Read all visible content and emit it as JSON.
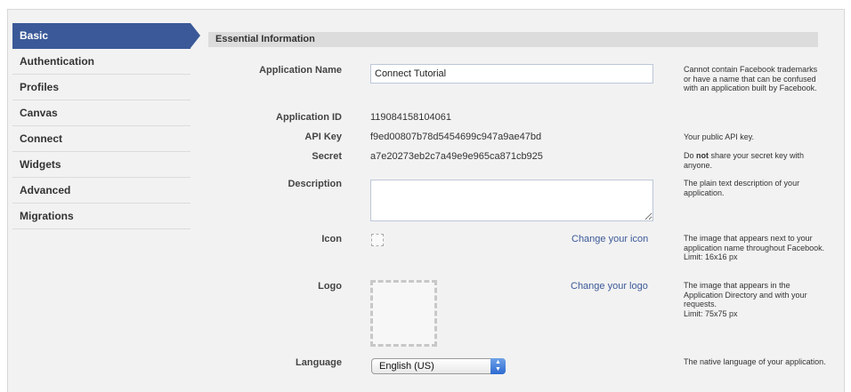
{
  "sidebar": {
    "items": [
      {
        "label": "Basic",
        "active": true
      },
      {
        "label": "Authentication"
      },
      {
        "label": "Profiles"
      },
      {
        "label": "Canvas"
      },
      {
        "label": "Connect"
      },
      {
        "label": "Widgets"
      },
      {
        "label": "Advanced"
      },
      {
        "label": "Migrations"
      }
    ]
  },
  "section": {
    "title": "Essential Information"
  },
  "fields": {
    "app_name": {
      "label": "Application Name",
      "value": "Connect Tutorial",
      "help": "Cannot contain Facebook trademarks or have a name that can be confused with an application built by Facebook."
    },
    "app_id": {
      "label": "Application ID",
      "value": "119084158104061"
    },
    "api_key": {
      "label": "API Key",
      "value": "f9ed00807b78d5454699c947a9ae47bd",
      "help": "Your public API key."
    },
    "secret": {
      "label": "Secret",
      "value": "a7e20273eb2c7a49e9e965ca871cb925",
      "help_pre": "Do ",
      "help_bold": "not",
      "help_post": " share your secret key with anyone."
    },
    "description": {
      "label": "Description",
      "value": "",
      "help": "The plain text description of your application."
    },
    "icon": {
      "label": "Icon",
      "link": "Change your icon",
      "help": "The image that appears next to your application name throughout Facebook.",
      "limit": "Limit: 16x16 px"
    },
    "logo": {
      "label": "Logo",
      "link": "Change your logo",
      "help": "The image that appears in the Application Directory and with your requests.",
      "limit": "Limit: 75x75 px"
    },
    "language": {
      "label": "Language",
      "value": "English (US)",
      "help": "The native language of your application."
    }
  },
  "colors": {
    "accent": "#3b5998",
    "header_bg": "#dcdcdc",
    "panel_bg": "#f2f2f2"
  }
}
